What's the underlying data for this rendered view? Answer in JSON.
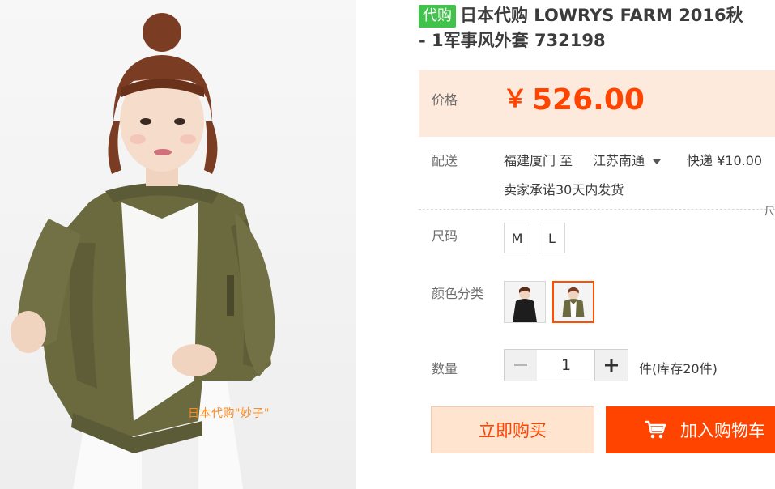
{
  "product": {
    "badge": "代购",
    "title_line1": "日本代购 LOWRYS FARM 2016秋",
    "title_line2": "- 1军事风外套 732198",
    "watermark": "日本代购\"妙子\""
  },
  "price": {
    "label": "价格",
    "currency": "￥",
    "value": "526.00",
    "color": "#ff4400"
  },
  "shipping": {
    "label": "配送",
    "from": "福建厦门",
    "to_word": "至",
    "destination": "江苏南通",
    "method_fee": "快递 ¥10.00",
    "promise": "卖家承诺30天内发货",
    "cut_char": "尺"
  },
  "size": {
    "label": "尺码",
    "options": [
      "M",
      "L"
    ]
  },
  "color": {
    "label": "颜色分类",
    "selected_index": 1
  },
  "quantity": {
    "label": "数量",
    "value": "1",
    "minus": "−",
    "plus": "+",
    "stock_text": "件(库存20件)"
  },
  "actions": {
    "buy_now": "立即购买",
    "add_to_cart": "加入购物车"
  },
  "colors": {
    "accent": "#ff4400",
    "price_bg": "#fee9dd",
    "badge_bg": "#41c34b",
    "jacket": "#6b6a3f"
  }
}
